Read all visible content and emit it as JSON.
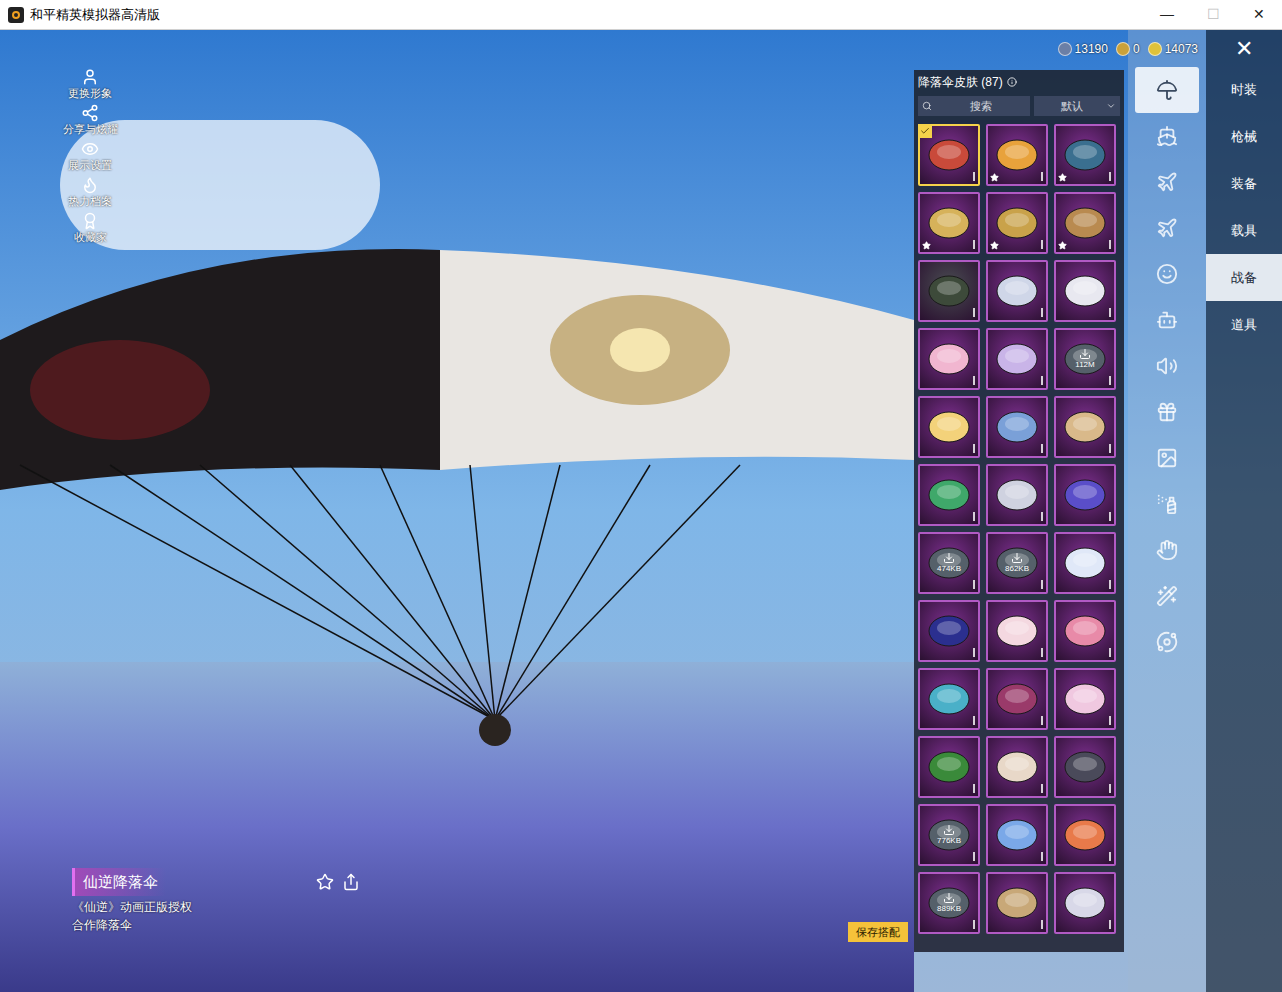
{
  "window": {
    "title": "和平精英模拟器高清版",
    "controls": [
      {
        "label": "—",
        "disabled": false
      },
      {
        "label": "☐",
        "disabled": true
      },
      {
        "label": "✕",
        "disabled": false
      }
    ]
  },
  "currency": [
    {
      "value": "13190",
      "color": "#6b7fa6"
    },
    {
      "value": "0",
      "color": "#c9a13a"
    },
    {
      "value": "14073",
      "color": "#e0c23a"
    }
  ],
  "close": "✕",
  "left_menu": [
    "更换形象",
    "分享与炫耀",
    "展示设置",
    "热力档案",
    "收藏家"
  ],
  "panel": {
    "title": "降落伞皮肤 (87)"
  },
  "search": {
    "placeholder": "搜索"
  },
  "sort": {
    "value": "默认"
  },
  "items": [
    {
      "selected": true,
      "starred": false,
      "download": "",
      "color": "#7d2f8f"
    },
    {
      "selected": false,
      "starred": true,
      "download": "",
      "color": "#7d2f8f"
    },
    {
      "selected": false,
      "starred": true,
      "download": "",
      "color": "#7d2f8f"
    },
    {
      "selected": false,
      "starred": true,
      "download": "",
      "color": "#7d2f8f"
    },
    {
      "selected": false,
      "starred": true,
      "download": "",
      "color": "#7d2f8f"
    },
    {
      "selected": false,
      "starred": true,
      "download": "",
      "color": "#7d2f8f"
    },
    {
      "selected": false,
      "starred": false,
      "download": "",
      "color": "#4a4d52"
    },
    {
      "selected": false,
      "starred": false,
      "download": "",
      "color": "#7d2f8f"
    },
    {
      "selected": false,
      "starred": false,
      "download": "",
      "color": "#7d2f8f"
    },
    {
      "selected": false,
      "starred": false,
      "download": "",
      "color": "#7d2f8f"
    },
    {
      "selected": false,
      "starred": false,
      "download": "",
      "color": "#7d2f8f"
    },
    {
      "selected": false,
      "starred": false,
      "download": "112M",
      "color": "#7d2f8f"
    },
    {
      "selected": false,
      "starred": false,
      "download": "",
      "color": "#7d2f8f"
    },
    {
      "selected": false,
      "starred": false,
      "download": "",
      "color": "#7d2f8f"
    },
    {
      "selected": false,
      "starred": false,
      "download": "",
      "color": "#7d2f8f"
    },
    {
      "selected": false,
      "starred": false,
      "download": "",
      "color": "#7d2f8f"
    },
    {
      "selected": false,
      "starred": false,
      "download": "",
      "color": "#7d2f8f"
    },
    {
      "selected": false,
      "starred": false,
      "download": "",
      "color": "#7d2f8f"
    },
    {
      "selected": false,
      "starred": false,
      "download": "474KB",
      "color": "#7d2f8f"
    },
    {
      "selected": false,
      "starred": false,
      "download": "862KB",
      "color": "#7d2f8f"
    },
    {
      "selected": false,
      "starred": false,
      "download": "",
      "color": "#7d2f8f"
    },
    {
      "selected": false,
      "starred": false,
      "download": "",
      "color": "#7d2f8f"
    },
    {
      "selected": false,
      "starred": false,
      "download": "",
      "color": "#7d2f8f"
    },
    {
      "selected": false,
      "starred": false,
      "download": "",
      "color": "#7d2f8f"
    },
    {
      "selected": false,
      "starred": false,
      "download": "",
      "color": "#7d2f8f"
    },
    {
      "selected": false,
      "starred": false,
      "download": "",
      "color": "#7d2f8f"
    },
    {
      "selected": false,
      "starred": false,
      "download": "",
      "color": "#7d2f8f"
    },
    {
      "selected": false,
      "starred": false,
      "download": "",
      "color": "#7d2f8f"
    },
    {
      "selected": false,
      "starred": false,
      "download": "",
      "color": "#7d2f8f"
    },
    {
      "selected": false,
      "starred": false,
      "download": "",
      "color": "#7d2f8f"
    },
    {
      "selected": false,
      "starred": false,
      "download": "776KB",
      "color": "#7d2f8f"
    },
    {
      "selected": false,
      "starred": false,
      "download": "",
      "color": "#7d2f8f"
    },
    {
      "selected": false,
      "starred": false,
      "download": "",
      "color": "#7d2f8f"
    },
    {
      "selected": false,
      "starred": false,
      "download": "889KB",
      "color": "#7d2f8f"
    },
    {
      "selected": false,
      "starred": false,
      "download": "",
      "color": "#7d2f8f"
    },
    {
      "selected": false,
      "starred": false,
      "download": "",
      "color": "#7d2f8f"
    }
  ],
  "categories": [
    {
      "selected": true
    },
    {
      "selected": false
    },
    {
      "selected": false
    },
    {
      "selected": false
    },
    {
      "selected": false
    },
    {
      "selected": false
    },
    {
      "selected": false
    },
    {
      "selected": false
    },
    {
      "selected": false
    },
    {
      "selected": false
    },
    {
      "selected": false
    },
    {
      "selected": false
    },
    {
      "selected": false
    }
  ],
  "tabs": [
    {
      "label": "时装",
      "selected": false
    },
    {
      "label": "枪械",
      "selected": false
    },
    {
      "label": "装备",
      "selected": false
    },
    {
      "label": "载具",
      "selected": false
    },
    {
      "label": "战备",
      "selected": true
    },
    {
      "label": "道具",
      "selected": false
    }
  ],
  "item_info": {
    "name": "仙逆降落伞",
    "lines": [
      "《仙逆》动画正版授权",
      "合作降落伞"
    ]
  },
  "save_button": "保存搭配"
}
